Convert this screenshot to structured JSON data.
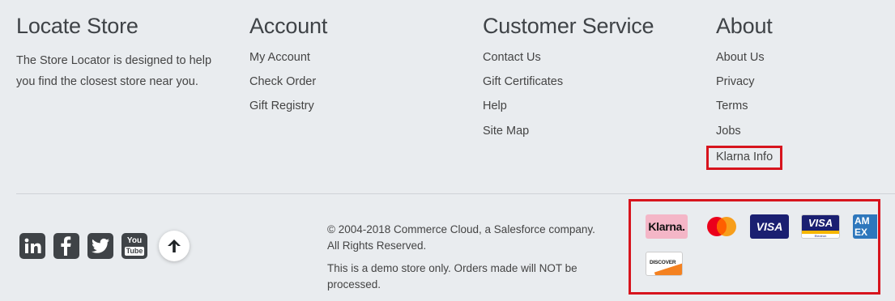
{
  "columns": {
    "locate": {
      "title": "Locate Store",
      "text": "The Store Locator is designed to help you find the closest store near you."
    },
    "account": {
      "title": "Account",
      "links": [
        "My Account",
        "Check Order",
        "Gift Registry"
      ]
    },
    "service": {
      "title": "Customer Service",
      "links": [
        "Contact Us",
        "Gift Certificates",
        "Help",
        "Site Map"
      ]
    },
    "about": {
      "title": "About",
      "links": [
        "About Us",
        "Privacy",
        "Terms",
        "Jobs",
        "Klarna Info"
      ]
    }
  },
  "social": {
    "icons": [
      "linkedin-icon",
      "facebook-icon",
      "twitter-icon",
      "youtube-icon"
    ],
    "youtube_top": "You",
    "youtube_bottom": "Tube",
    "back_to_top_icon": "arrow-up-icon"
  },
  "copyright": {
    "line1": "© 2004-2018 Commerce Cloud, a Salesforce company. All Rights Reserved.",
    "line2": "This is a demo store only. Orders made will NOT be processed."
  },
  "payments": {
    "klarna": "Klarna.",
    "visa": "VISA",
    "visa_electron": "VISA",
    "visa_electron_sub": "Electron",
    "amex": "AM EX",
    "discover": "DISCOVER"
  },
  "colors": {
    "background": "#e9ecef",
    "highlight_border": "#d7141d",
    "icon_dark": "#3f4347"
  }
}
